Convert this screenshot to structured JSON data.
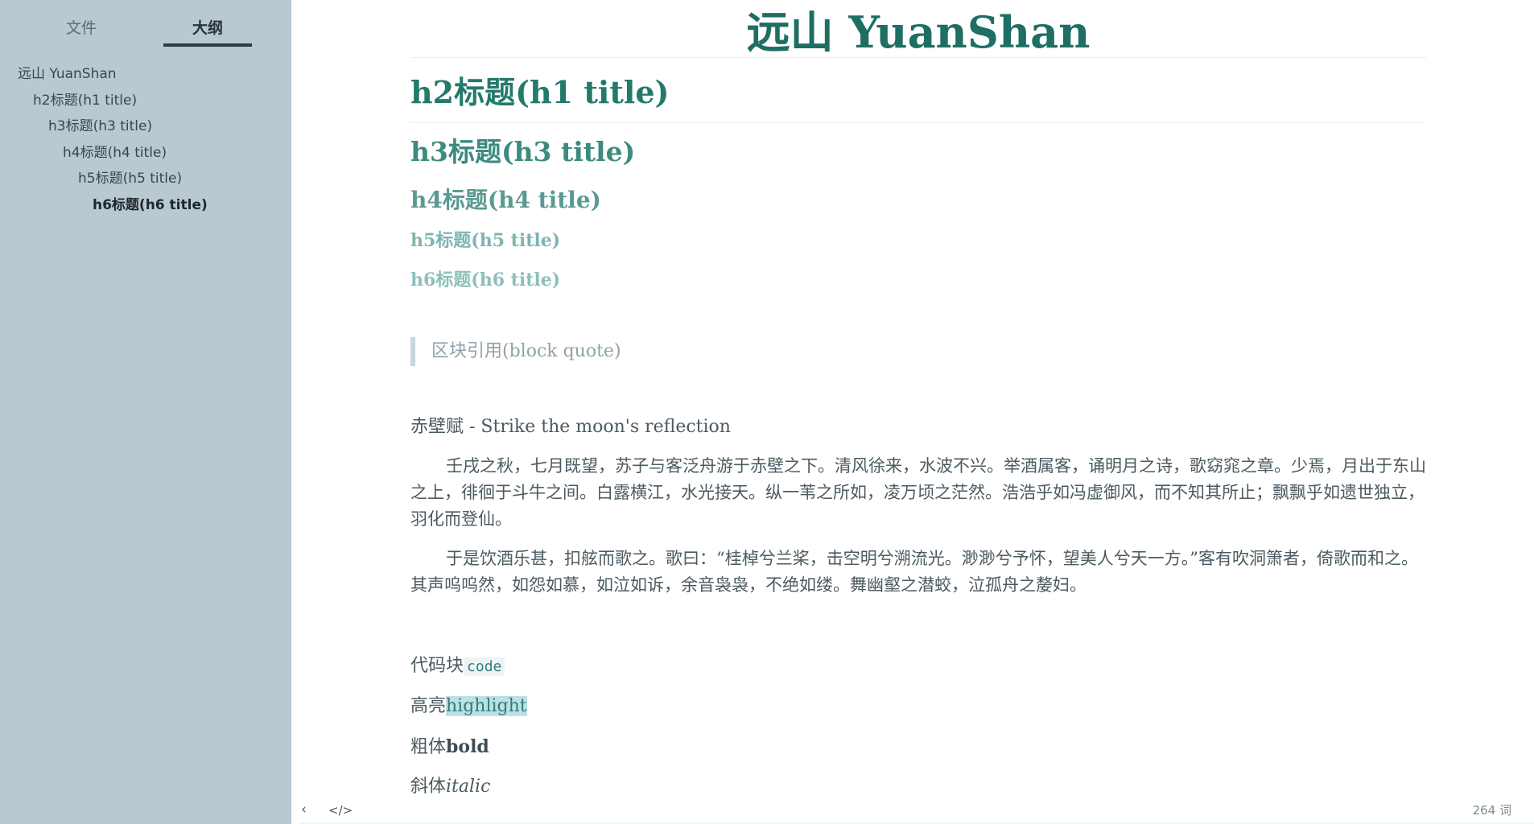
{
  "sidebar": {
    "tabs": [
      {
        "label": "文件"
      },
      {
        "label": "大纲"
      }
    ],
    "outline": [
      {
        "label": "远山 YuanShan"
      },
      {
        "label": "h2标题(h1 title)"
      },
      {
        "label": "h3标题(h3 title)"
      },
      {
        "label": "h4标题(h4 title)"
      },
      {
        "label": "h5标题(h5 title)"
      },
      {
        "label": "h6标题(h6 title)"
      }
    ],
    "footer": {
      "back_icon": "chevron-left-icon",
      "source_icon": "code-icon",
      "back_glyph": "‹",
      "source_glyph": "</>"
    }
  },
  "document": {
    "h1": "远山 YuanShan",
    "h2": "h2标题(h1 title)",
    "h3": "h3标题(h3 title)",
    "h4": "h4标题(h4 title)",
    "h5": "h5标题(h5 title)",
    "h6": "h6标题(h6 title)",
    "blockquote": "区块引用(block quote)",
    "para_title": "赤壁赋 - Strike the moon's reflection",
    "paragraphs": [
      "壬戌之秋，七月既望，苏子与客泛舟游于赤壁之下。清风徐来，水波不兴。举酒属客，诵明月之诗，歌窈窕之章。少焉，月出于东山之上，徘徊于斗牛之间。白露横江，水光接天。纵一苇之所如，凌万顷之茫然。浩浩乎如冯虚御风，而不知其所止；飘飘乎如遗世独立，羽化而登仙。",
      "于是饮酒乐甚，扣舷而歌之。歌曰：“桂棹兮兰桨，击空明兮溯流光。渺渺兮予怀，望美人兮天一方。”客有吹洞箫者，倚歌而和之。其声呜呜然，如怨如慕，如泣如诉，余音袅袅，不绝如缕。舞幽壑之潜蛟，泣孤舟之嫠妇。"
    ],
    "code_label": "代码块",
    "code_text": "code",
    "highlight_label": "高亮",
    "highlight_text": "highlight",
    "bold_label": "粗体",
    "bold_text": "bold",
    "italic_label": "斜体",
    "italic_text": "italic"
  },
  "status": {
    "word_count": "264 词"
  },
  "colors": {
    "sidebar_bg": "#b8c9d1",
    "accent": "#1e6e63"
  }
}
